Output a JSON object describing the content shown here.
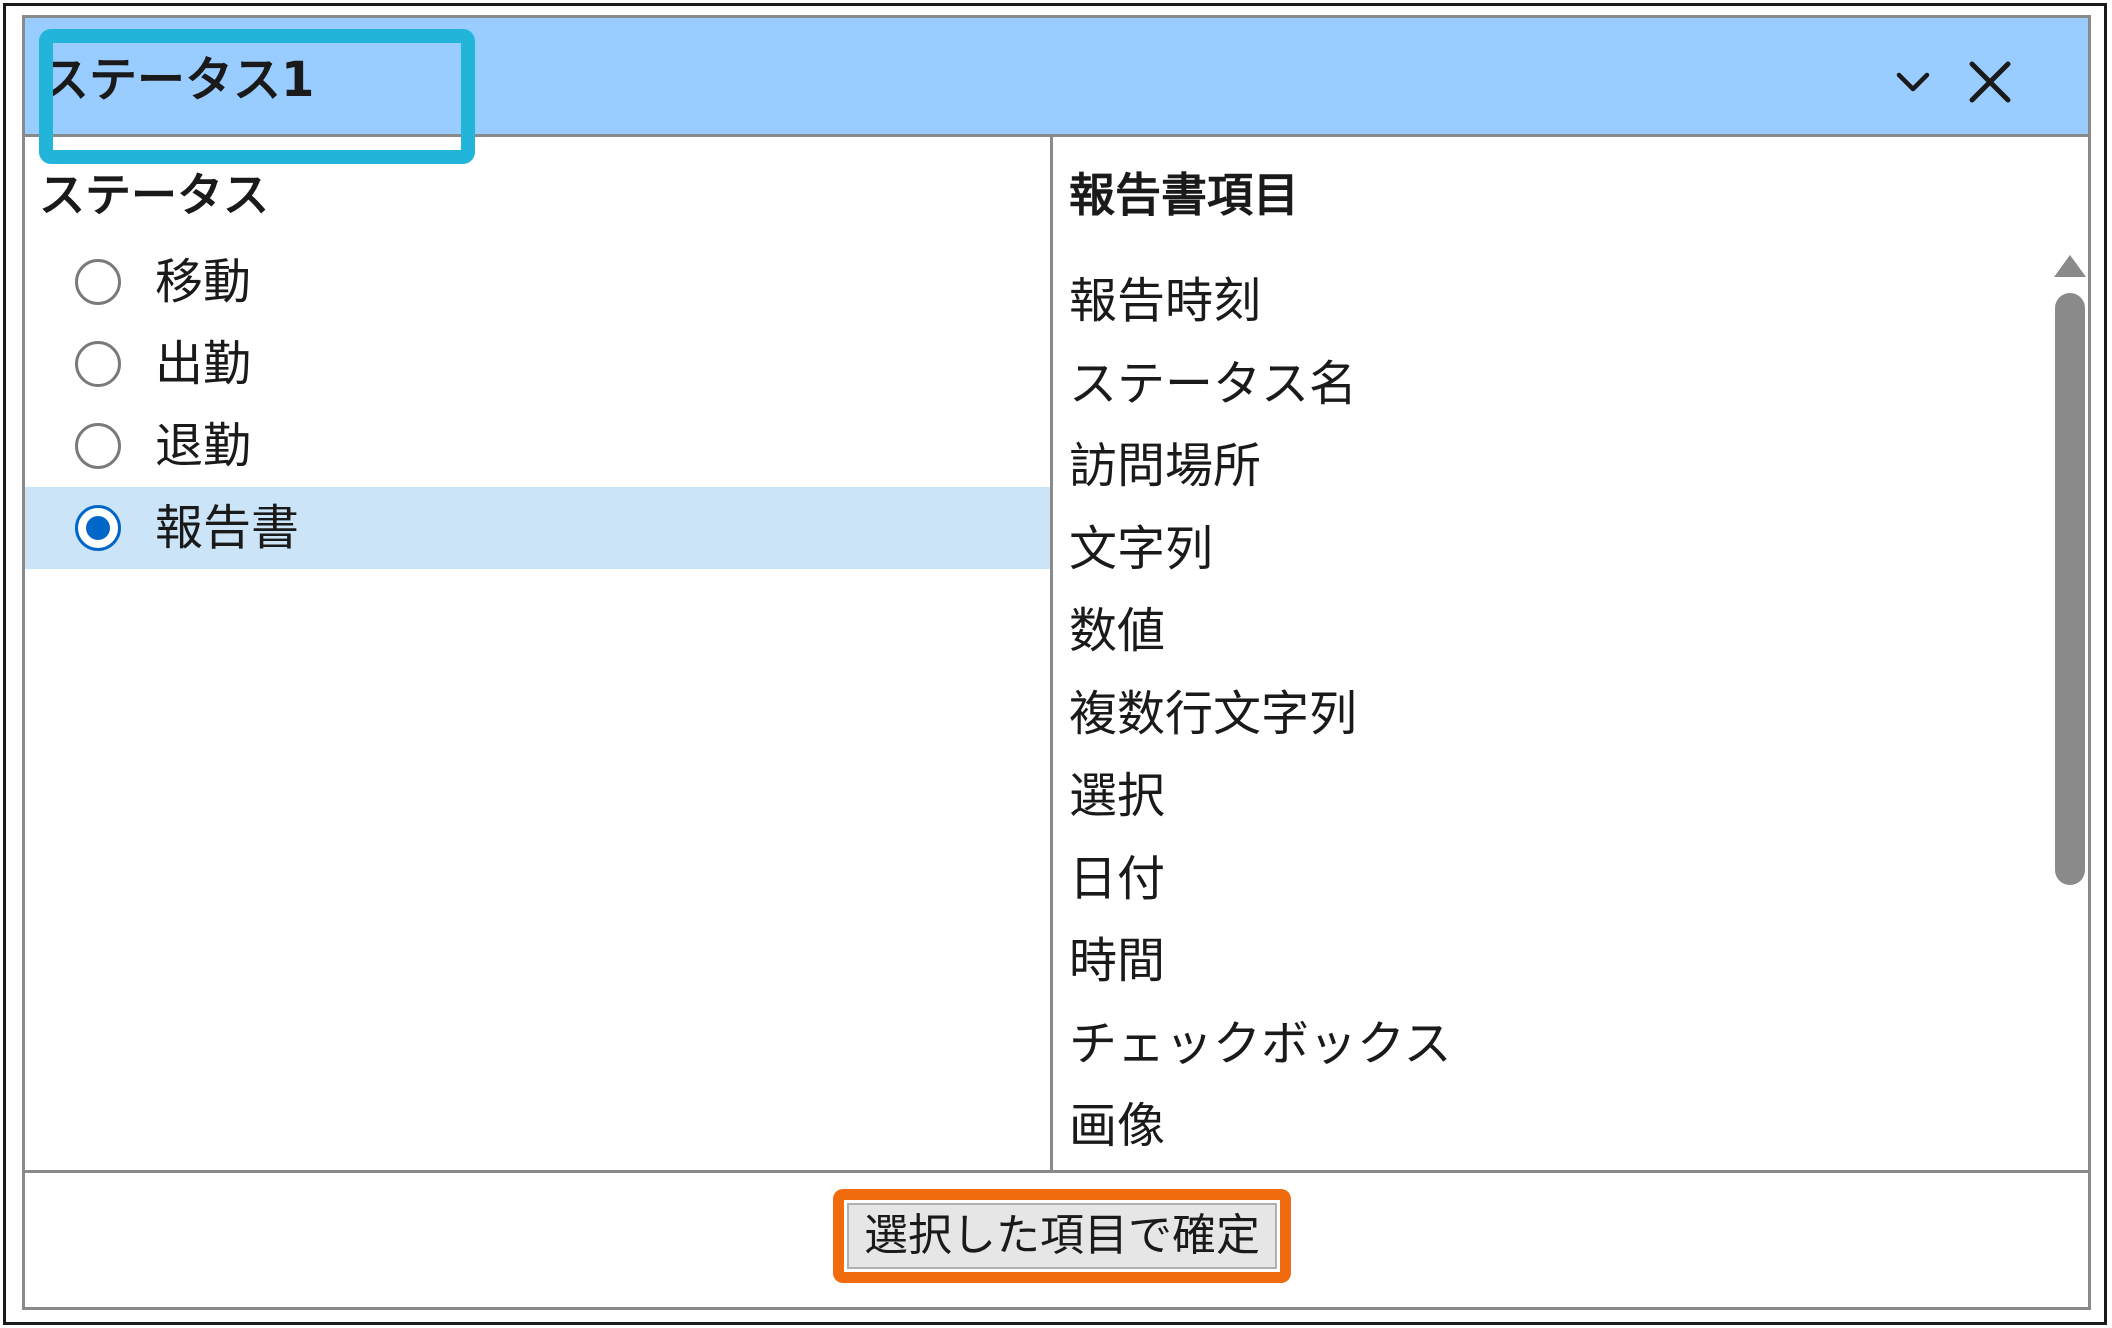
{
  "window": {
    "title": "ステータス1",
    "collapse_icon": "chevron-down-icon",
    "close_icon": "close-icon"
  },
  "status_panel": {
    "header": "ステータス",
    "items": [
      {
        "label": "移動",
        "selected": false
      },
      {
        "label": "出勤",
        "selected": false
      },
      {
        "label": "退勤",
        "selected": false
      },
      {
        "label": "報告書",
        "selected": true
      }
    ]
  },
  "report_panel": {
    "header": "報告書項目",
    "items": [
      "報告時刻",
      "ステータス名",
      "訪問場所",
      "文字列",
      "数値",
      "複数行文字列",
      "選択",
      "日付",
      "時間",
      "チェックボックス",
      "画像"
    ]
  },
  "footer": {
    "confirm_label": "選択した項目で確定"
  },
  "colors": {
    "title_bar": "#99ccff",
    "title_highlight": "#22b5d9",
    "confirm_highlight": "#f06a0e",
    "selected_row": "#cce4f7",
    "radio_checked": "#0066c8"
  }
}
